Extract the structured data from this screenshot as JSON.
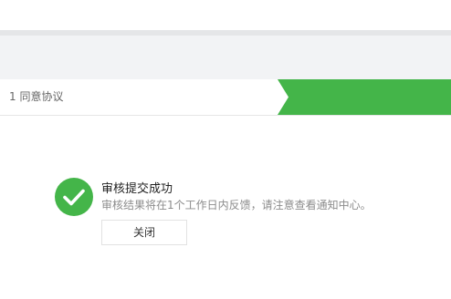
{
  "steps": {
    "step1_label": "1 同意协议"
  },
  "result": {
    "title": "审核提交成功",
    "description": "审核结果将在1个工作日内反馈，请注意查看通知中心。",
    "close_button_label": "关闭"
  },
  "colors": {
    "success_green": "#44b549",
    "header_band": "#f2f3f5",
    "divider": "#e5e6e8"
  },
  "icons": {
    "success": "check-circle-icon"
  }
}
